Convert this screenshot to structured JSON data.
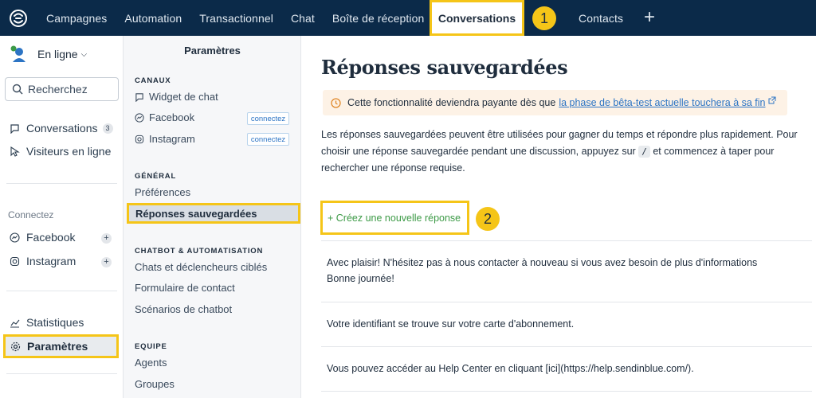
{
  "topnav": {
    "items": [
      "Campagnes",
      "Automation",
      "Transactionnel",
      "Chat",
      "Boîte de réception"
    ],
    "active": "Conversations",
    "after": "Contacts",
    "marker1": "1",
    "plus": "+"
  },
  "sidebar": {
    "status": "En ligne",
    "search_placeholder": "Recherchez",
    "conversations": "Conversations",
    "conversations_count": "3",
    "visitors": "Visiteurs en ligne",
    "connect_label": "Connectez",
    "facebook": "Facebook",
    "instagram": "Instagram",
    "statistics": "Statistiques",
    "settings": "Paramètres"
  },
  "midpanel": {
    "title": "Paramètres",
    "sec_channels": "CANAUX",
    "widget": "Widget de chat",
    "facebook": "Facebook",
    "instagram": "Instagram",
    "connect_btn": "connectez",
    "sec_general": "GÉNÉRAL",
    "preferences": "Préférences",
    "saved_replies": "Réponses sauvegardées",
    "sec_chatbot": "CHATBOT & AUTOMATISATION",
    "chats_triggers": "Chats et déclencheurs ciblés",
    "contact_form": "Formulaire de contact",
    "chatbot_scenarios": "Scénarios de chatbot",
    "sec_team": "EQUIPE",
    "agents": "Agents",
    "groups": "Groupes"
  },
  "main": {
    "title": "Réponses sauvegardées",
    "notice_text": "Cette fonctionnalité deviendra payante dès que",
    "notice_link": "la phase de bêta-test actuelle touchera à sa fin",
    "desc_1": "Les réponses sauvegardées peuvent être utilisées pour gagner du temps et répondre plus rapidement. Pour choisir une réponse sauvegardée pendant une discussion, appuyez sur",
    "desc_key": "/",
    "desc_2": "et commencez à taper pour rechercher une réponse requise.",
    "create_link": "+ Créez une nouvelle réponse",
    "marker2": "2",
    "replies": [
      "Avec plaisir! N'hésitez pas à nous contacter à nouveau si vous avez besoin de plus d'informations",
      "Bonne journée!",
      "Votre identifiant se trouve sur votre carte d'abonnement.",
      "Vous pouvez accéder au Help Center en cliquant [ici](https://help.sendinblue.com/)."
    ]
  },
  "colors": {
    "nav_bg": "#0b2a49",
    "highlight": "#f5c518",
    "link": "#2c74c4",
    "create": "#3c9a46",
    "notice_bg": "#fdf2e6"
  }
}
